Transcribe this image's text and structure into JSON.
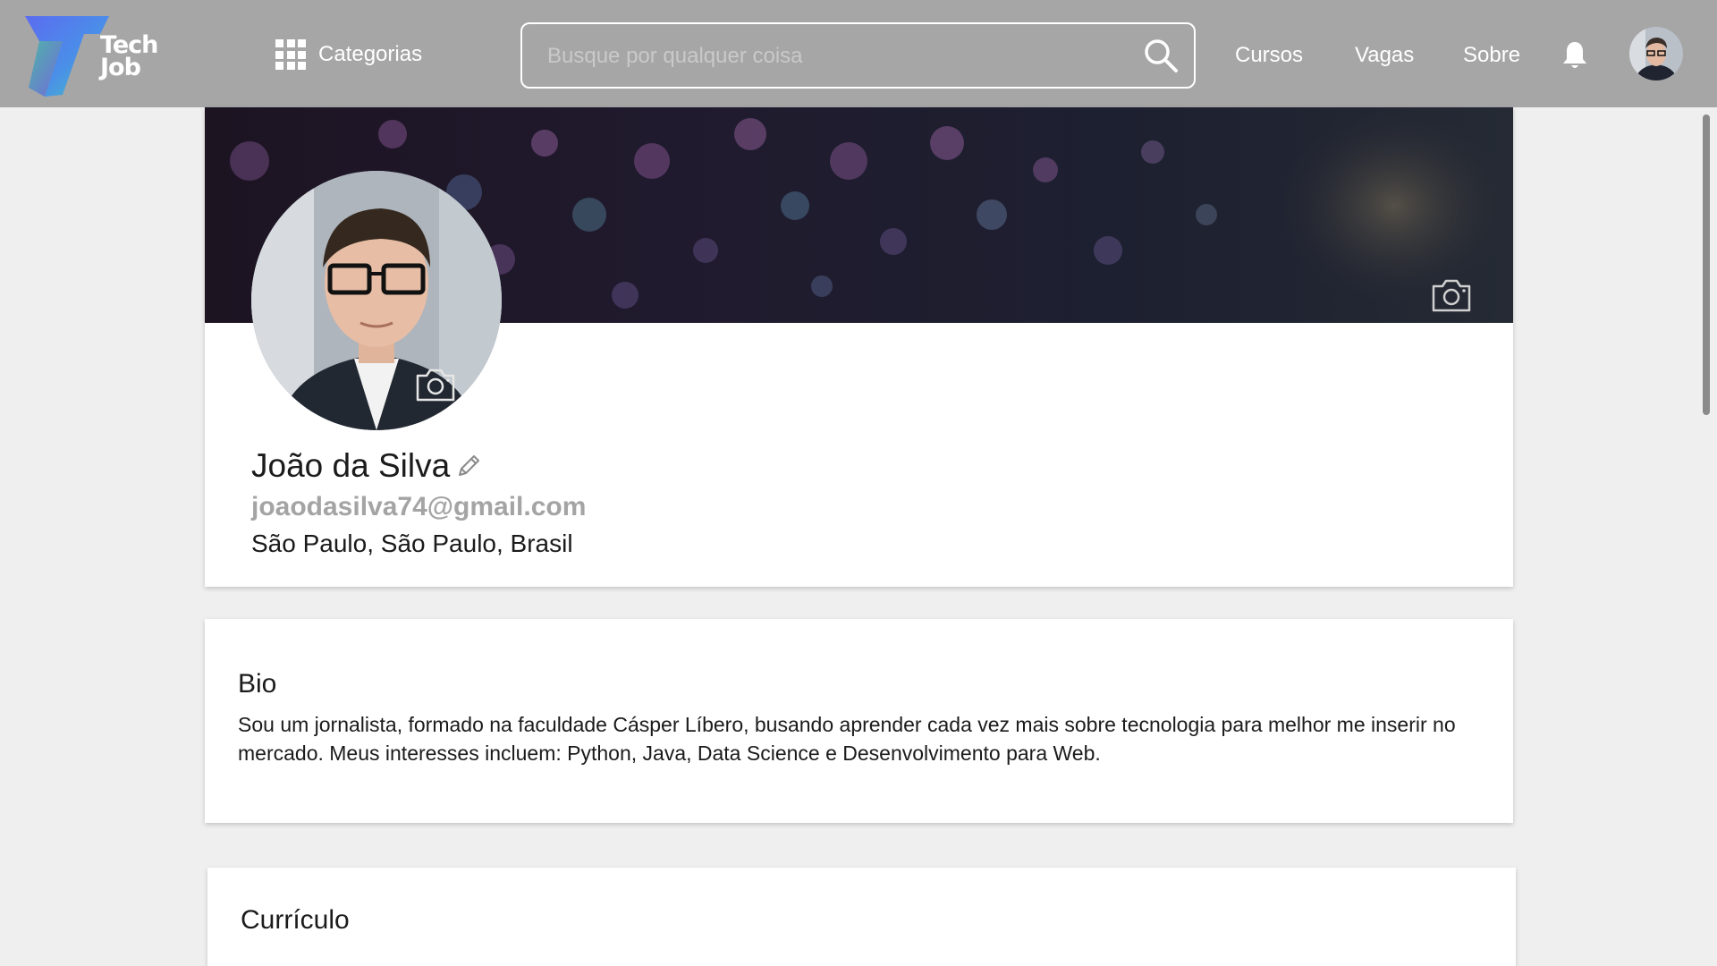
{
  "header": {
    "logo": {
      "line1": "Tech",
      "line2": "Job"
    },
    "categories": {
      "label": "Categorias",
      "icon": "grid-icon"
    },
    "search": {
      "placeholder": "Busque por qualquer coisa",
      "value": "",
      "icon": "search-icon"
    },
    "nav": [
      {
        "label": "Cursos"
      },
      {
        "label": "Vagas"
      },
      {
        "label": "Sobre"
      }
    ],
    "notification_icon": "bell-icon",
    "avatar_icon": "user-avatar"
  },
  "profile": {
    "name": "João da Silva",
    "email": "joaodasilva74@gmail.com",
    "location": "São Paulo, São Paulo, Brasil",
    "edit_icon": "pencil-icon",
    "cover_camera_icon": "camera-icon",
    "avatar_camera_icon": "camera-icon"
  },
  "bio": {
    "title": "Bio",
    "text": "Sou um jornalista, formado na faculdade Cásper Líbero, busando aprender cada vez mais sobre tecnologia para melhor me inserir no mercado. Meus interesses incluem: Python, Java, Data Science e Desenvolvimento para Web."
  },
  "curriculum": {
    "title": "Currículo"
  },
  "colors": {
    "header_bg": "#a6a6a6",
    "page_bg": "#efefef",
    "card_bg": "#ffffff",
    "email_text": "#a4a4a4"
  }
}
